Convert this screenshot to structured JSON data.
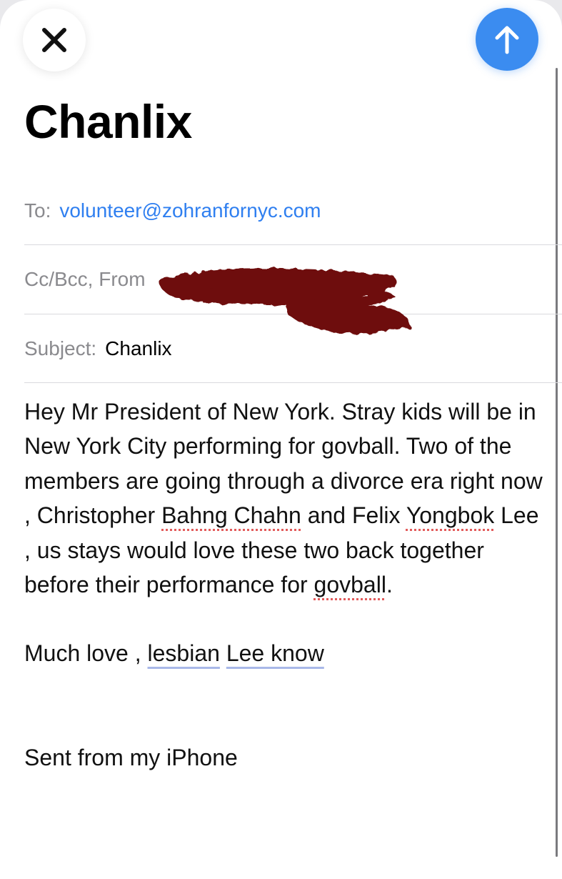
{
  "compose": {
    "title": "Chanlix",
    "to_label": "To:",
    "to_value": "volunteer@zohranfornyc.com",
    "ccbcc_label": "Cc/Bcc, From",
    "subject_label": "Subject:",
    "subject_value": "Chanlix"
  },
  "body": {
    "para1": [
      "Hey Mr President of New York. Stray kids will be in New York City performing for govball. Two of the members are going through a divorce era right now , Christopher ",
      "Bahng Chahn",
      " and Felix ",
      "Yongbok",
      " Lee , us stays would love these two back together before their performance for ",
      "govball",
      "."
    ],
    "sign_off": [
      "Much love , ",
      "lesbian",
      " ",
      "Lee know"
    ],
    "signature": "Sent from my iPhone"
  },
  "icons": {
    "close": "close-x-icon",
    "send": "arrow-up-icon"
  },
  "colors": {
    "send_button": "#3b8cf0",
    "recipient_link": "#2f7ff0",
    "redaction": "#6e0f0f"
  }
}
